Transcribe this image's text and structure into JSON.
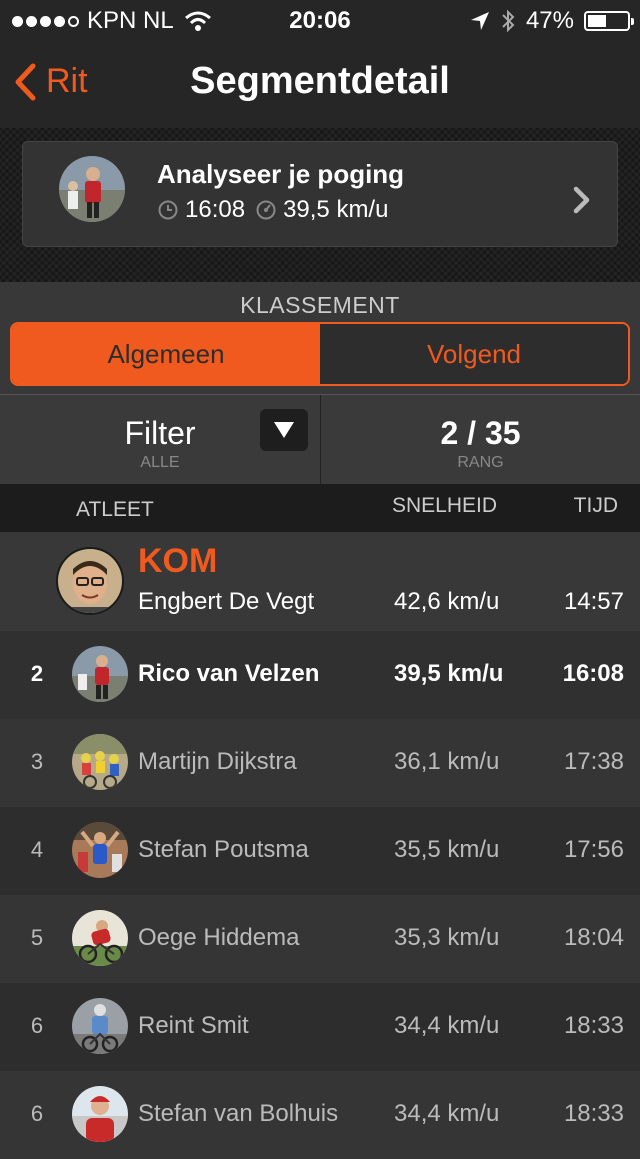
{
  "status_bar": {
    "carrier": "KPN NL",
    "time": "20:06",
    "battery": "47%",
    "battery_level": 0.47,
    "signal_bars": 4,
    "signal_max": 5
  },
  "nav": {
    "back_label": "Rit",
    "title": "Segmentdetail"
  },
  "attempt_card": {
    "title": "Analyseer je poging",
    "time": "16:08",
    "speed": "39,5 km/u"
  },
  "leaderboard": {
    "section_label": "KLASSEMENT",
    "tabs": [
      "Algemeen",
      "Volgend"
    ],
    "active_tab": "Algemeen",
    "filter_label": "Filter",
    "filter_value": "ALLE",
    "rank": "2 / 35",
    "rank_label": "RANG",
    "columns": {
      "athlete": "ATLEET",
      "speed": "SNELHEID",
      "time": "TIJD"
    },
    "kom": {
      "label": "KOM",
      "name": "Engbert De Vegt",
      "speed": "42,6 km/u",
      "time": "14:57"
    },
    "entries": [
      {
        "rank": "2",
        "name": "Rico van Velzen",
        "speed": "39,5 km/u",
        "time": "16:08"
      },
      {
        "rank": "3",
        "name": "Martijn Dijkstra",
        "speed": "36,1 km/u",
        "time": "17:38"
      },
      {
        "rank": "4",
        "name": "Stefan Poutsma",
        "speed": "35,5 km/u",
        "time": "17:56"
      },
      {
        "rank": "5",
        "name": "Oege Hiddema",
        "speed": "35,3 km/u",
        "time": "18:04"
      },
      {
        "rank": "6",
        "name": "Reint Smit",
        "speed": "34,4 km/u",
        "time": "18:33"
      },
      {
        "rank": "6",
        "name": "Stefan van Bolhuis",
        "speed": "34,4 km/u",
        "time": "18:33"
      }
    ]
  },
  "colors": {
    "accent": "#f05a1e",
    "background": "#2d2d2d",
    "bar": "#262626"
  }
}
